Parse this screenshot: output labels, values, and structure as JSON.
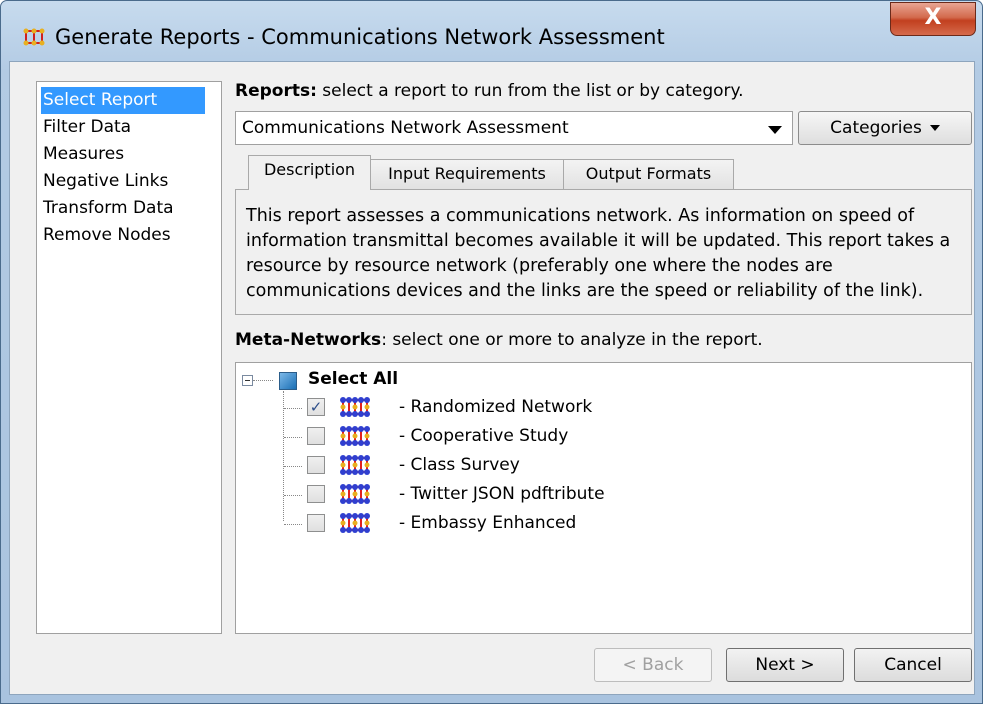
{
  "window": {
    "title": "Generate Reports - Communications Network Assessment",
    "close_label": "X"
  },
  "nav": {
    "items": [
      {
        "label": "Select Report",
        "selected": true
      },
      {
        "label": "Filter Data"
      },
      {
        "label": "Measures"
      },
      {
        "label": "Negative Links"
      },
      {
        "label": "Transform Data"
      },
      {
        "label": "Remove Nodes"
      }
    ]
  },
  "reports": {
    "label_bold": "Reports:",
    "label_rest": " select a report to run from the list or by category.",
    "selected": "Communications Network Assessment",
    "categories_label": "Categories"
  },
  "tabs": [
    {
      "label": "Description",
      "active": true
    },
    {
      "label": "Input Requirements"
    },
    {
      "label": "Output Formats"
    }
  ],
  "description": "This report assesses a communications network. As information on speed of information transmittal becomes available it will be updated. This report takes a resource by resource network (preferably one where the nodes are communications devices and the links are the speed or reliability of the link).",
  "meta": {
    "label_bold": "Meta-Networks",
    "label_rest": ": select one or more to analyze in the report.",
    "select_all": "Select All",
    "items": [
      {
        "label": "- Randomized Network",
        "checked": true
      },
      {
        "label": "- Cooperative Study",
        "checked": false
      },
      {
        "label": "- Class Survey",
        "checked": false
      },
      {
        "label": "- Twitter JSON pdftribute",
        "checked": false
      },
      {
        "label": "- Embassy Enhanced",
        "checked": false
      }
    ]
  },
  "buttons": {
    "back": "< Back",
    "next": "Next >",
    "cancel": "Cancel"
  },
  "colors": {
    "selection": "#3399ff",
    "network_icon_node": "#2f3fd0",
    "network_icon_link": "#e02020"
  }
}
